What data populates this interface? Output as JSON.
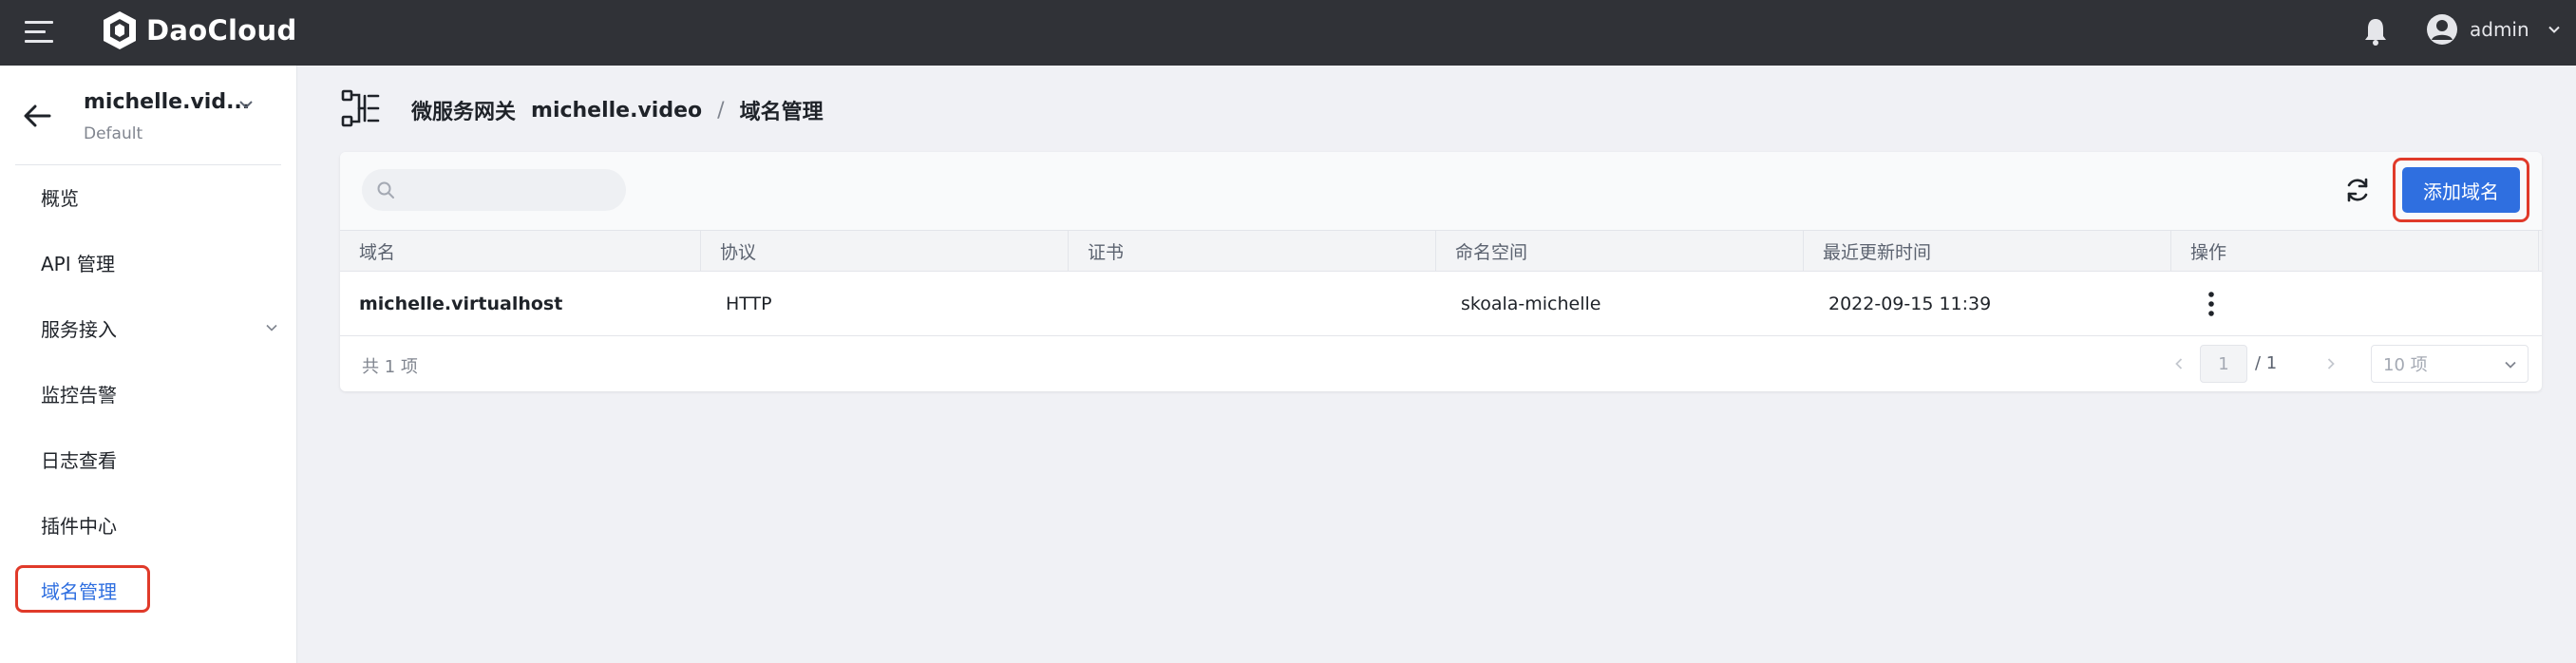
{
  "topbar": {
    "brand": "DaoCloud",
    "user_name": "admin"
  },
  "sidebar": {
    "workspace_name": "michelle.vid...",
    "workspace_sub": "Default",
    "items": [
      {
        "label": "概览"
      },
      {
        "label": "API 管理"
      },
      {
        "label": "服务接入"
      },
      {
        "label": "监控告警"
      },
      {
        "label": "日志查看"
      },
      {
        "label": "插件中心"
      },
      {
        "label": "域名管理"
      }
    ],
    "active_item": "域名管理"
  },
  "breadcrumb": {
    "section": "微服务网关",
    "gateway": "michelle.video",
    "separator": "/",
    "page": "域名管理"
  },
  "toolbar": {
    "search_placeholder": "",
    "add_label": "添加域名"
  },
  "table": {
    "columns": [
      "域名",
      "协议",
      "证书",
      "命名空间",
      "最近更新时间",
      "操作"
    ],
    "rows": [
      {
        "domain": "michelle.virtualhost",
        "protocol": "HTTP",
        "certificate": "",
        "namespace": "skoala-michelle",
        "updated": "2022-09-15 11:39"
      }
    ]
  },
  "footer": {
    "total": "共 1 项",
    "page_current": "1",
    "page_total": "/ 1",
    "page_size": "10 项"
  },
  "colors": {
    "topbar": "#303237",
    "accent": "#2f6fe0",
    "highlight": "#e03a2a"
  }
}
